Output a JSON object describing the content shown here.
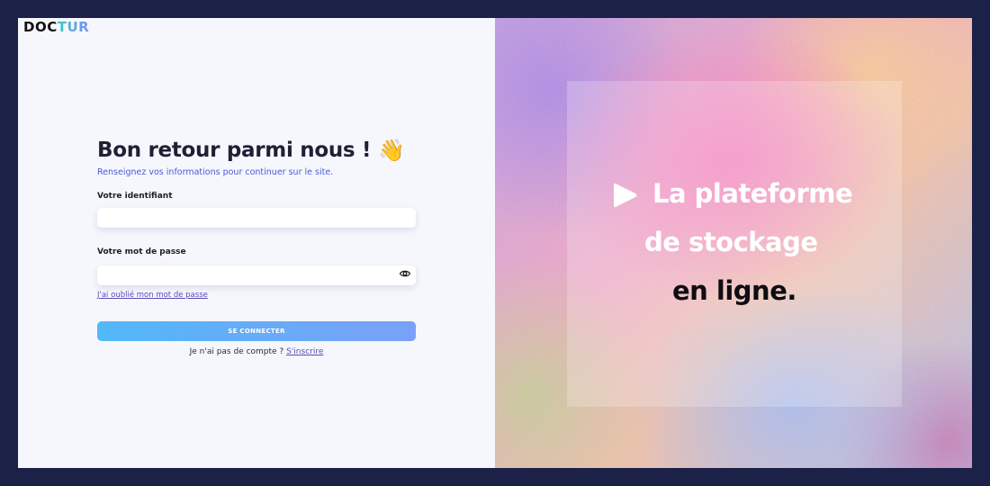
{
  "brand": {
    "logo_part1": "DOC",
    "logo_part2": "TUR"
  },
  "login": {
    "title": "Bon retour parmi nous !",
    "title_emoji": "👋",
    "subtitle": "Renseignez vos informations pour continuer sur le site.",
    "username_label": "Votre identifiant",
    "username_value": "",
    "password_label": "Votre mot de passe",
    "password_value": "",
    "forgot_link": "J'ai oublié mon mot de passe",
    "submit_label": "SE CONNECTER",
    "signup_prompt": "Je n'ai pas de compte ?",
    "signup_link": "S'inscrire"
  },
  "hero": {
    "line1": "La plateforme",
    "line2": "de stockage",
    "line3": "en ligne."
  },
  "colors": {
    "page_bg": "#1c2148",
    "panel_bg": "#f6f7fd",
    "link": "#5a4ab8",
    "subtitle": "#4a5ad6",
    "button_start": "#52b8f8",
    "button_end": "#7aa0f8"
  },
  "icons": {
    "password_toggle": "eye-icon",
    "hero_play": "play-icon",
    "waving_hand": "waving-hand-icon"
  }
}
